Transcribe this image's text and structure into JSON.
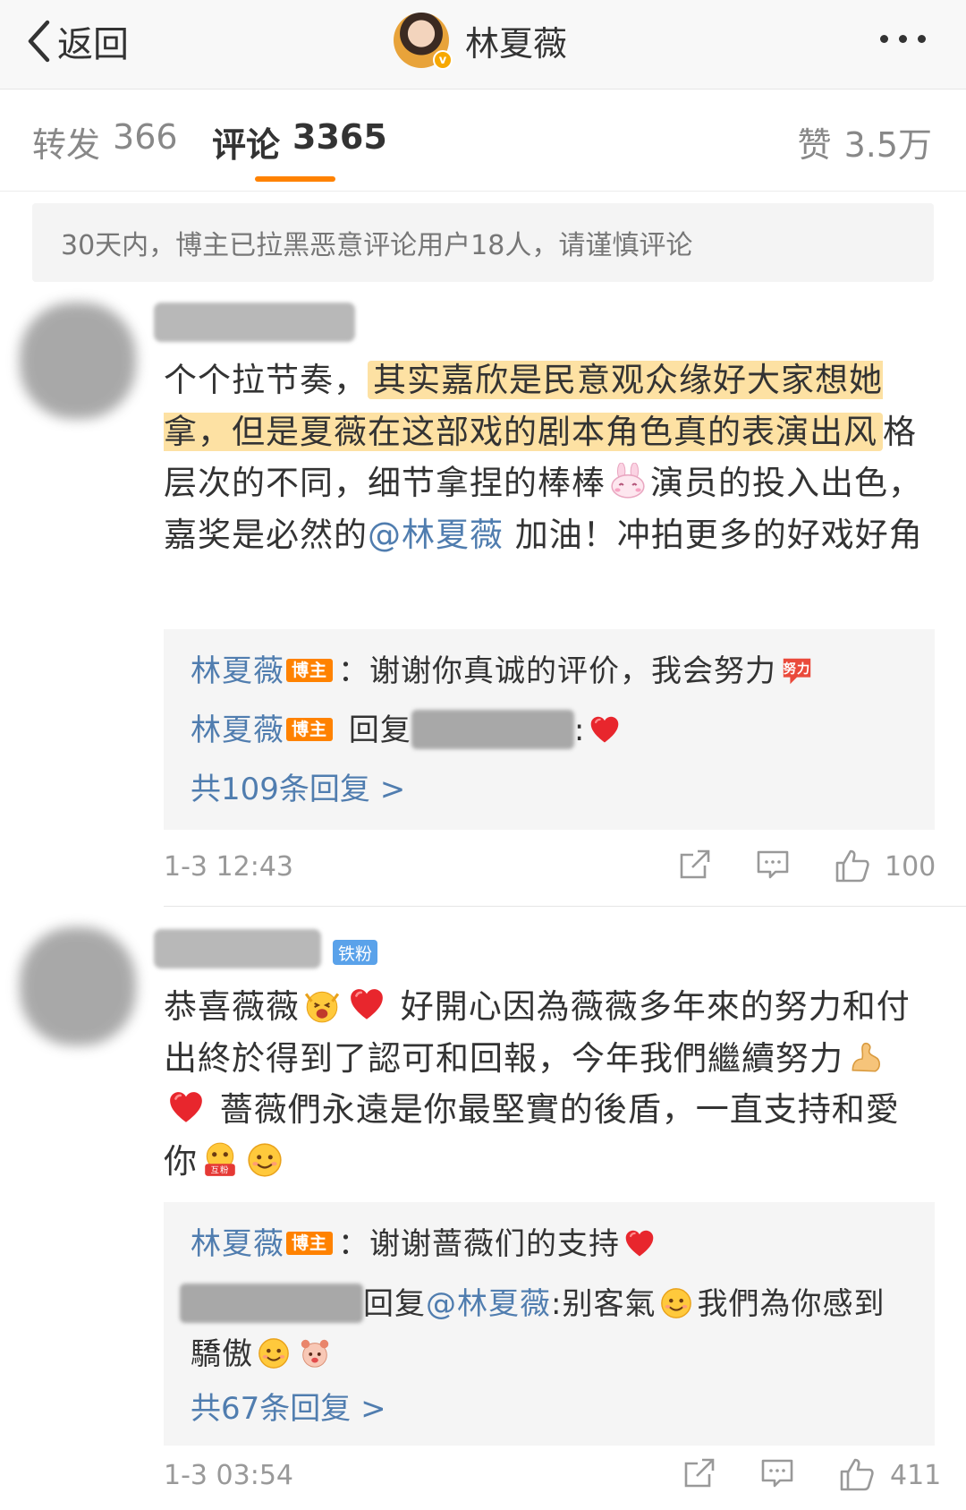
{
  "nav": {
    "back_label": "返回",
    "profile_name": "林夏薇",
    "verified_mark": "v"
  },
  "tabs": {
    "repost_label": "转发",
    "repost_count": "366",
    "comment_label": "评论",
    "comment_count": "3365",
    "like_label": "赞",
    "like_count": "3.5万"
  },
  "notice": "30天内，博主已拉黑恶意评论用户18人，请谨慎评论",
  "comments": [
    {
      "text_part1": "个个拉节奏，",
      "text_highlight": "其实嘉欣是民意观众缘好大家想她拿，但是夏薇在这部戏的剧本角色真的表演出风",
      "text_part2": "格层次的不同，细节拿捏的棒棒",
      "text_part3": "演员的投入出色，嘉奖是必然的",
      "mention": "@林夏薇",
      "text_part4": " 加油！冲拍更多的好戏好角",
      "replies": [
        {
          "name": "林夏薇",
          "badge": "博主",
          "text": "：谢谢你真诚的评价，我会努力"
        },
        {
          "name": "林夏薇",
          "badge": "博主",
          "reply_word": " 回复",
          "text": ":"
        }
      ],
      "more_replies": "共109条回复 >",
      "time": "1-3 12:43",
      "likes": "100"
    },
    {
      "fan_badge": "铁粉",
      "text_part1": "恭喜薇薇",
      "text_part2": "好開心因為薇薇多年來的努力和付出終於得到了認可和回報，今年我們繼續努力",
      "text_part3": "薔薇們永遠是你最堅實的後盾，一直支持和愛你",
      "replies": [
        {
          "name": "林夏薇",
          "badge": "博主",
          "text": "：谢谢蔷薇们的支持"
        },
        {
          "reply_word": "回复",
          "mention": "@林夏薇",
          "text": ":别客氣",
          "text2": "我們為你感到驕傲"
        }
      ],
      "more_replies": "共67条回复 >",
      "time": "1-3 03:54",
      "likes": "411"
    }
  ],
  "icons": {
    "back": "chevron-left-icon",
    "more": "more-dots-icon",
    "share": "share-icon",
    "comment": "comment-icon",
    "like": "thumbs-up-icon",
    "heart": "heart-icon"
  },
  "colors": {
    "accent": "#ff8200",
    "link": "#507daf",
    "highlight": "#fde1a3",
    "fan_badge": "#5aa2ea"
  }
}
